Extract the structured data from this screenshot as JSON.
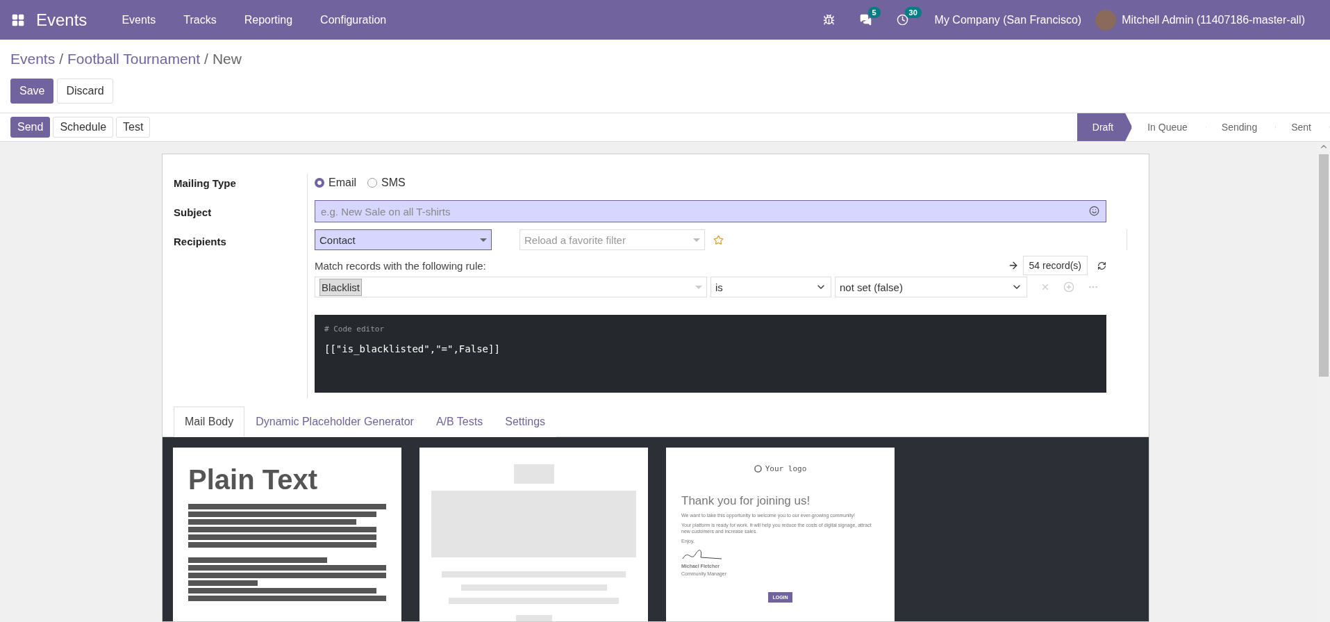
{
  "navbar": {
    "app_name": "Events",
    "menu": [
      "Events",
      "Tracks",
      "Reporting",
      "Configuration"
    ],
    "messages_badge": "5",
    "activities_badge": "30",
    "company": "My Company (San Francisco)",
    "user": "Mitchell Admin (11407186-master-all)"
  },
  "breadcrumb": {
    "items": [
      "Events",
      "Football Tournament"
    ],
    "separators": [
      "/",
      "/"
    ],
    "current": "New"
  },
  "form_buttons": [
    {
      "label": "Save",
      "kind": "primary"
    },
    {
      "label": "Discard",
      "kind": "secondary"
    }
  ],
  "action_buttons": [
    {
      "label": "Send",
      "kind": "primary"
    },
    {
      "label": "Schedule",
      "kind": "secondary"
    },
    {
      "label": "Test",
      "kind": "secondary"
    }
  ],
  "status_steps": [
    {
      "label": "Draft",
      "selected": true
    },
    {
      "label": "In Queue",
      "selected": false
    },
    {
      "label": "Sending",
      "selected": false
    },
    {
      "label": "Sent",
      "selected": false
    }
  ],
  "form": {
    "mailing_type": {
      "label": "Mailing Type",
      "options": [
        {
          "label": "Email",
          "selected": true
        },
        {
          "label": "SMS",
          "selected": false
        }
      ]
    },
    "subject": {
      "label": "Subject",
      "placeholder": "e.g. New Sale on all T-shirts"
    },
    "recipients": {
      "label": "Recipients",
      "model": "Contact",
      "filter_placeholder": "Reload a favorite filter",
      "rule_text": "Match records with the following rule:",
      "records": "54 record(s)",
      "rule": {
        "field": "Blacklist",
        "operator": "is",
        "value": "not set (false)"
      },
      "code_comment": "# Code editor",
      "code": "[[\"is_blacklisted\",\"=\",False]]"
    }
  },
  "tabs": [
    {
      "label": "Mail Body",
      "selected": true
    },
    {
      "label": "Dynamic Placeholder Generator",
      "selected": false
    },
    {
      "label": "A/B Tests",
      "selected": false
    },
    {
      "label": "Settings",
      "selected": false
    }
  ],
  "templates": [
    {
      "kind": "plain",
      "title": "Plain Text"
    },
    {
      "kind": "blank"
    },
    {
      "kind": "welcome",
      "logo": "Your logo",
      "heading": "Thank you for joining us!",
      "paragraphs": [
        "We want to take this opportunity to welcome you to our ever-growing community!",
        "Your platform is ready for work. It will help you reduce the costs of digital signage, attract new customers and increase sales.",
        "Enjoy,"
      ],
      "signer": "Michael Fletcher",
      "signer_role": "Community Manager",
      "button": "LOGIN"
    }
  ]
}
